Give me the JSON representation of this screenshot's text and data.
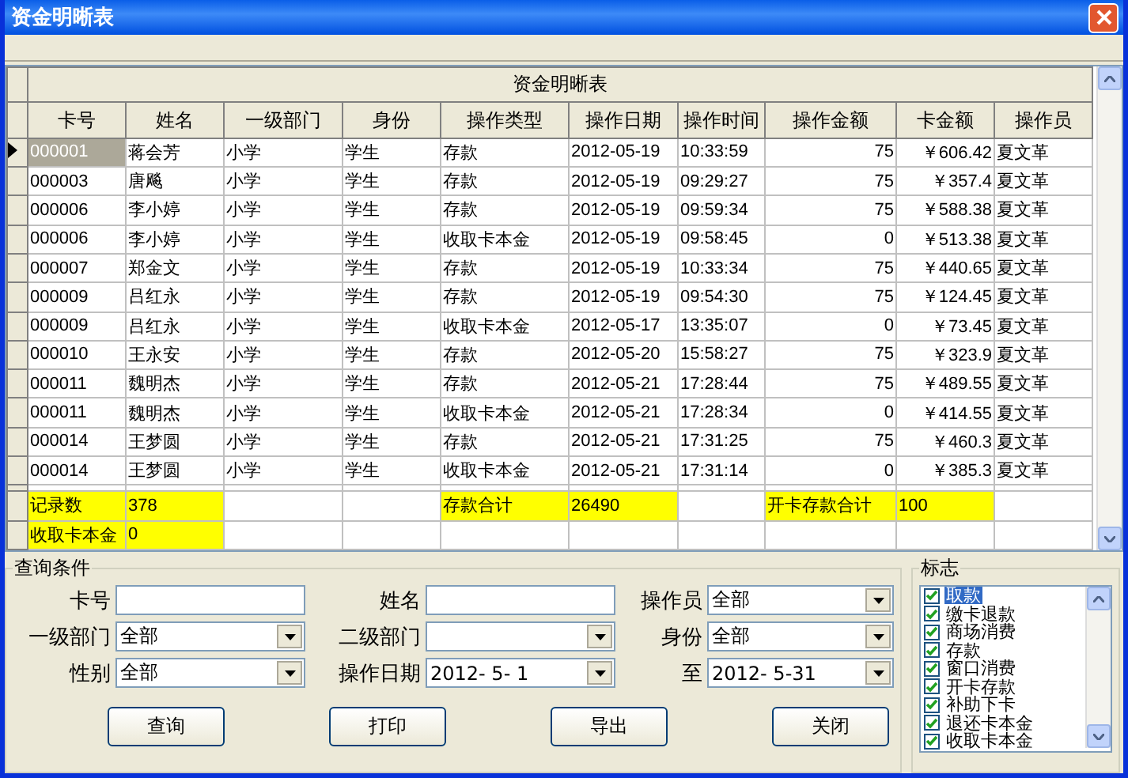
{
  "window": {
    "title": "资金明晰表"
  },
  "table": {
    "title": "资金明晰表",
    "columns": [
      "卡号",
      "姓名",
      "一级部门",
      "身份",
      "操作类型",
      "操作日期",
      "操作时间",
      "操作金额",
      "卡金额",
      "操作员"
    ],
    "rows": [
      {
        "selected": true,
        "cells": [
          "000001",
          "蒋会芳",
          "小学",
          "学生",
          "存款",
          "2012-05-19",
          "10:33:59",
          "75",
          "￥606.42",
          "夏文革"
        ]
      },
      {
        "selected": false,
        "cells": [
          "000003",
          "唐飚",
          "小学",
          "学生",
          "存款",
          "2012-05-19",
          "09:29:27",
          "75",
          "￥357.4",
          "夏文革"
        ]
      },
      {
        "selected": false,
        "cells": [
          "000006",
          "李小婷",
          "小学",
          "学生",
          "存款",
          "2012-05-19",
          "09:59:34",
          "75",
          "￥588.38",
          "夏文革"
        ]
      },
      {
        "selected": false,
        "cells": [
          "000006",
          "李小婷",
          "小学",
          "学生",
          "收取卡本金",
          "2012-05-19",
          "09:58:45",
          "0",
          "￥513.38",
          "夏文革"
        ]
      },
      {
        "selected": false,
        "cells": [
          "000007",
          "郑金文",
          "小学",
          "学生",
          "存款",
          "2012-05-19",
          "10:33:34",
          "75",
          "￥440.65",
          "夏文革"
        ]
      },
      {
        "selected": false,
        "cells": [
          "000009",
          "吕红永",
          "小学",
          "学生",
          "存款",
          "2012-05-19",
          "09:54:30",
          "75",
          "￥124.45",
          "夏文革"
        ]
      },
      {
        "selected": false,
        "cells": [
          "000009",
          "吕红永",
          "小学",
          "学生",
          "收取卡本金",
          "2012-05-17",
          "13:35:07",
          "0",
          "￥73.45",
          "夏文革"
        ]
      },
      {
        "selected": false,
        "cells": [
          "000010",
          "王永安",
          "小学",
          "学生",
          "存款",
          "2012-05-20",
          "15:58:27",
          "75",
          "￥323.9",
          "夏文革"
        ]
      },
      {
        "selected": false,
        "cells": [
          "000011",
          "魏明杰",
          "小学",
          "学生",
          "存款",
          "2012-05-21",
          "17:28:44",
          "75",
          "￥489.55",
          "夏文革"
        ]
      },
      {
        "selected": false,
        "cells": [
          "000011",
          "魏明杰",
          "小学",
          "学生",
          "收取卡本金",
          "2012-05-21",
          "17:28:34",
          "0",
          "￥414.55",
          "夏文革"
        ]
      },
      {
        "selected": false,
        "cells": [
          "000014",
          "王梦圆",
          "小学",
          "学生",
          "存款",
          "2012-05-21",
          "17:31:25",
          "75",
          "￥460.3",
          "夏文革"
        ]
      },
      {
        "selected": false,
        "cells": [
          "000014",
          "王梦圆",
          "小学",
          "学生",
          "收取卡本金",
          "2012-05-21",
          "17:31:14",
          "0",
          "￥385.3",
          "夏文革"
        ]
      }
    ],
    "summary": [
      [
        {
          "text": "记录数",
          "highlighted": true
        },
        {
          "text": "378",
          "highlighted": true
        },
        {
          "highlighted": false
        },
        {
          "highlighted": false
        },
        {
          "text": "存款合计",
          "highlighted": true
        },
        {
          "text": "26490",
          "highlighted": true
        },
        {
          "highlighted": false
        },
        {
          "text": "开卡存款合计",
          "highlighted": true
        },
        {
          "text": "100",
          "highlighted": true
        },
        {
          "highlighted": false
        }
      ],
      [
        {
          "text": "收取卡本金",
          "highlighted": true
        },
        {
          "text": "0",
          "highlighted": true
        },
        {
          "highlighted": false
        },
        {
          "highlighted": false
        },
        {
          "highlighted": false
        },
        {
          "highlighted": false
        },
        {
          "highlighted": false
        },
        {
          "highlighted": false
        },
        {
          "highlighted": false
        },
        {
          "highlighted": false
        }
      ]
    ]
  },
  "query": {
    "title": "查询条件",
    "fields": [
      {
        "label": "卡号",
        "kind": "text"
      },
      {
        "label": "姓名",
        "kind": "text"
      },
      {
        "label": "操作员",
        "kind": "combo",
        "value": "全部"
      },
      {
        "label": "一级部门",
        "kind": "combo",
        "value": "全部"
      },
      {
        "label": "二级部门",
        "kind": "combo"
      },
      {
        "label": "身份",
        "kind": "combo",
        "value": "全部"
      },
      {
        "label": "性别",
        "kind": "combo",
        "value": "全部"
      },
      {
        "label": "操作日期",
        "kind": "date",
        "value": "2012- 5- 1"
      },
      {
        "label": "至",
        "kind": "date",
        "value": "2012- 5-31"
      }
    ],
    "buttons": [
      "查询",
      "打印",
      "导出",
      "关闭"
    ]
  },
  "flags": {
    "title": "标志",
    "items": [
      {
        "label": "取款",
        "checked": true,
        "selected": true
      },
      {
        "label": "缴卡退款",
        "checked": true,
        "selected": false
      },
      {
        "label": "商场消费",
        "checked": true,
        "selected": false
      },
      {
        "label": "存款",
        "checked": true,
        "selected": false
      },
      {
        "label": "窗口消费",
        "checked": true,
        "selected": false
      },
      {
        "label": "开卡存款",
        "checked": true,
        "selected": false
      },
      {
        "label": "补助下卡",
        "checked": true,
        "selected": false
      },
      {
        "label": "退还卡本金",
        "checked": true,
        "selected": false
      },
      {
        "label": "收取卡本金",
        "checked": true,
        "selected": false
      }
    ]
  }
}
